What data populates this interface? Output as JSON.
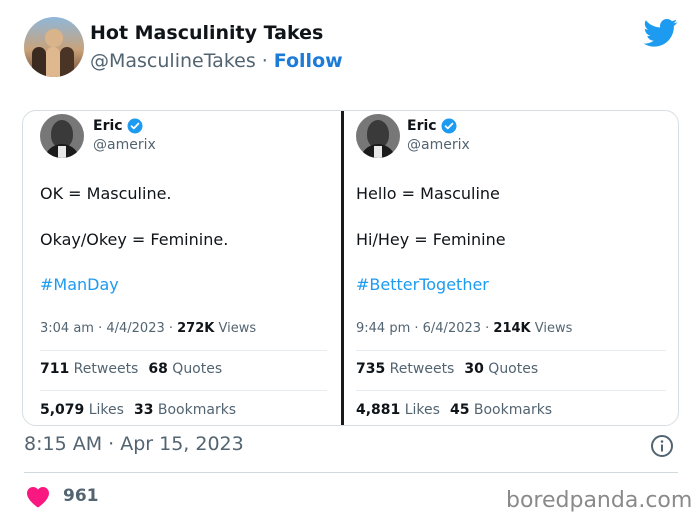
{
  "header": {
    "author_name": "Hot Masculinity Takes",
    "author_handle": "@MasculineTakes",
    "separator": "·",
    "follow_label": "Follow",
    "icon": "twitter-bird-icon"
  },
  "embedded": {
    "left": {
      "name": "Eric",
      "handle": "@amerix",
      "line1": "OK = Masculine.",
      "line2": "Okay/Okey = Feminine.",
      "hashtag": "#ManDay",
      "time_date": "3:04 am · 4/4/2023 · ",
      "views_count": "272K",
      "views_label": " Views",
      "retweets_count": "711",
      "retweets_label": " Retweets",
      "quotes_count": "68",
      "quotes_label": " Quotes",
      "likes_count": "5,079",
      "likes_label": " Likes",
      "bookmarks_count": "33",
      "bookmarks_label": " Bookmarks"
    },
    "right": {
      "name": "Eric",
      "handle": "@amerix",
      "line1": "Hello = Masculine",
      "line2": "Hi/Hey = Feminine",
      "hashtag": "#BetterTogether",
      "time_date": "9:44 pm · 6/4/2023 · ",
      "views_count": "214K",
      "views_label": " Views",
      "retweets_count": "735",
      "retweets_label": " Retweets",
      "quotes_count": "30",
      "quotes_label": " Quotes",
      "likes_count": "4,881",
      "likes_label": " Likes",
      "bookmarks_count": "45",
      "bookmarks_label": " Bookmarks"
    }
  },
  "footer": {
    "timestamp": "8:15 AM · Apr 15, 2023",
    "likes_count": "961",
    "watermark": "boredpanda.com"
  },
  "colors": {
    "twitter_blue": "#1d9bf0",
    "follow_blue": "#1d7bd8",
    "heart_red": "#f91880",
    "text_secondary": "#536471"
  }
}
